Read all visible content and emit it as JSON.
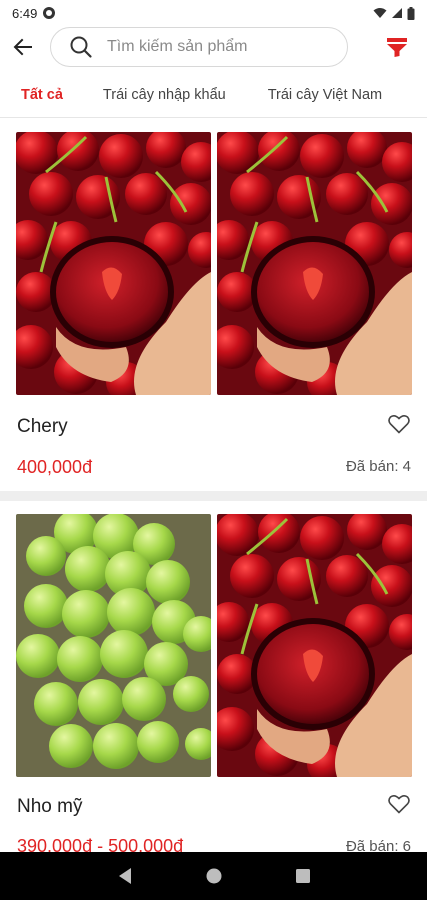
{
  "status_bar": {
    "time": "6:49"
  },
  "search": {
    "placeholder": "Tìm kiếm sản phẩm"
  },
  "tabs": [
    {
      "label": "Tất cả",
      "active": true
    },
    {
      "label": "Trái cây nhập khẩu",
      "active": false
    },
    {
      "label": "Trái cây Việt Nam",
      "active": false
    }
  ],
  "products": [
    {
      "name": "Chery",
      "price": "400,000đ",
      "sold": "Đã bán: 4",
      "images": [
        "cherry-icon",
        "cherry-icon"
      ]
    },
    {
      "name": "Nho mỹ",
      "price": "390,000đ - 500,000đ",
      "sold": "Đã bán: 6",
      "images": [
        "grape-icon",
        "cherry-icon"
      ]
    }
  ],
  "colors": {
    "accent": "#e02424",
    "divider": "#eeeeee",
    "nav_bar": "#000000"
  }
}
